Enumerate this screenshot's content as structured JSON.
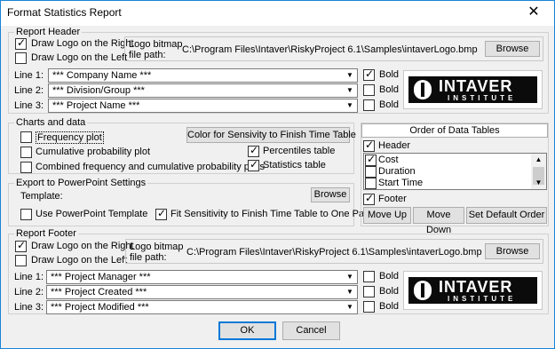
{
  "window": {
    "title": "Format Statistics Report",
    "close_glyph": "✕"
  },
  "report_header": {
    "legend": "Report Header",
    "draw_logo_right": {
      "label": "Draw Logo on the Right",
      "checked": true
    },
    "draw_logo_left": {
      "label": "Draw Logo on the Left",
      "checked": false
    },
    "logo_path_label_1": "Logo bitmap",
    "logo_path_label_2": "file path:",
    "logo_path": "C:\\Program Files\\Intaver\\RiskyProject 6.1\\Samples\\intaverLogo.bmp",
    "browse_label": "Browse",
    "lines": [
      {
        "label": "Line 1:",
        "value": "*** Company Name ***",
        "bold_label": "Bold",
        "bold": true
      },
      {
        "label": "Line 2:",
        "value": "*** Division/Group ***",
        "bold_label": "Bold",
        "bold": false
      },
      {
        "label": "Line 3:",
        "value": "*** Project Name ***",
        "bold_label": "Bold",
        "bold": false
      }
    ],
    "logo": {
      "big": "INTAVER",
      "small": "INSTITUTE"
    }
  },
  "charts_and_data": {
    "legend": "Charts and data",
    "frequency_plot": {
      "label": "Frequency plot",
      "checked": false
    },
    "cumulative_plot": {
      "label": "Cumulative probability plot",
      "checked": false
    },
    "combined_plot": {
      "label": "Combined frequency and cumulative probability plots",
      "checked": false
    },
    "color_button_label": "Color for Sensivity to Finish Time Table",
    "percentiles_table": {
      "label": "Percentiles table",
      "checked": true
    },
    "statistics_table": {
      "label": "Statistics table",
      "checked": true
    }
  },
  "powerpoint": {
    "legend": "Export to PowerPoint Settings",
    "template_label": "Template:",
    "browse_label": "Browse",
    "use_template": {
      "label": "Use PowerPoint Template",
      "checked": false
    },
    "fit_sensitivity": {
      "label": "Fit Sensitivity to Finish Time Table to One Page",
      "checked": true
    }
  },
  "order_of_tables": {
    "title": "Order of Data Tables",
    "header": {
      "label": "Header",
      "checked": true
    },
    "items": [
      {
        "label": "Cost",
        "checked": true
      },
      {
        "label": "Duration",
        "checked": false
      },
      {
        "label": "Start Time",
        "checked": false
      }
    ],
    "footer": {
      "label": "Footer",
      "checked": true
    },
    "move_up_label": "Move Up",
    "move_down_label": "Move Down",
    "set_default_label": "Set Default Order"
  },
  "report_footer": {
    "legend": "Report Footer",
    "draw_logo_right": {
      "label": "Draw Logo on the Right",
      "checked": true
    },
    "draw_logo_left": {
      "label": "Draw Logo on the Left",
      "checked": false
    },
    "logo_path_label_1": "Logo bitmap",
    "logo_path_label_2": "file path:",
    "logo_path": "C:\\Program Files\\Intaver\\RiskyProject 6.1\\Samples\\intaverLogo.bmp",
    "browse_label": "Browse",
    "lines": [
      {
        "label": "Line 1:",
        "value": "*** Project Manager ***",
        "bold_label": "Bold",
        "bold": false
      },
      {
        "label": "Line 2:",
        "value": "*** Project Created ***",
        "bold_label": "Bold",
        "bold": false
      },
      {
        "label": "Line 3:",
        "value": "*** Project Modified ***",
        "bold_label": "Bold",
        "bold": false
      }
    ],
    "logo": {
      "big": "INTAVER",
      "small": "INSTITUTE"
    }
  },
  "buttons": {
    "ok_label": "OK",
    "cancel_label": "Cancel"
  },
  "colors": {
    "window_border": "#1883d7",
    "dialog_bg": "#f0f0f0",
    "default_button_border": "#0078d7"
  }
}
